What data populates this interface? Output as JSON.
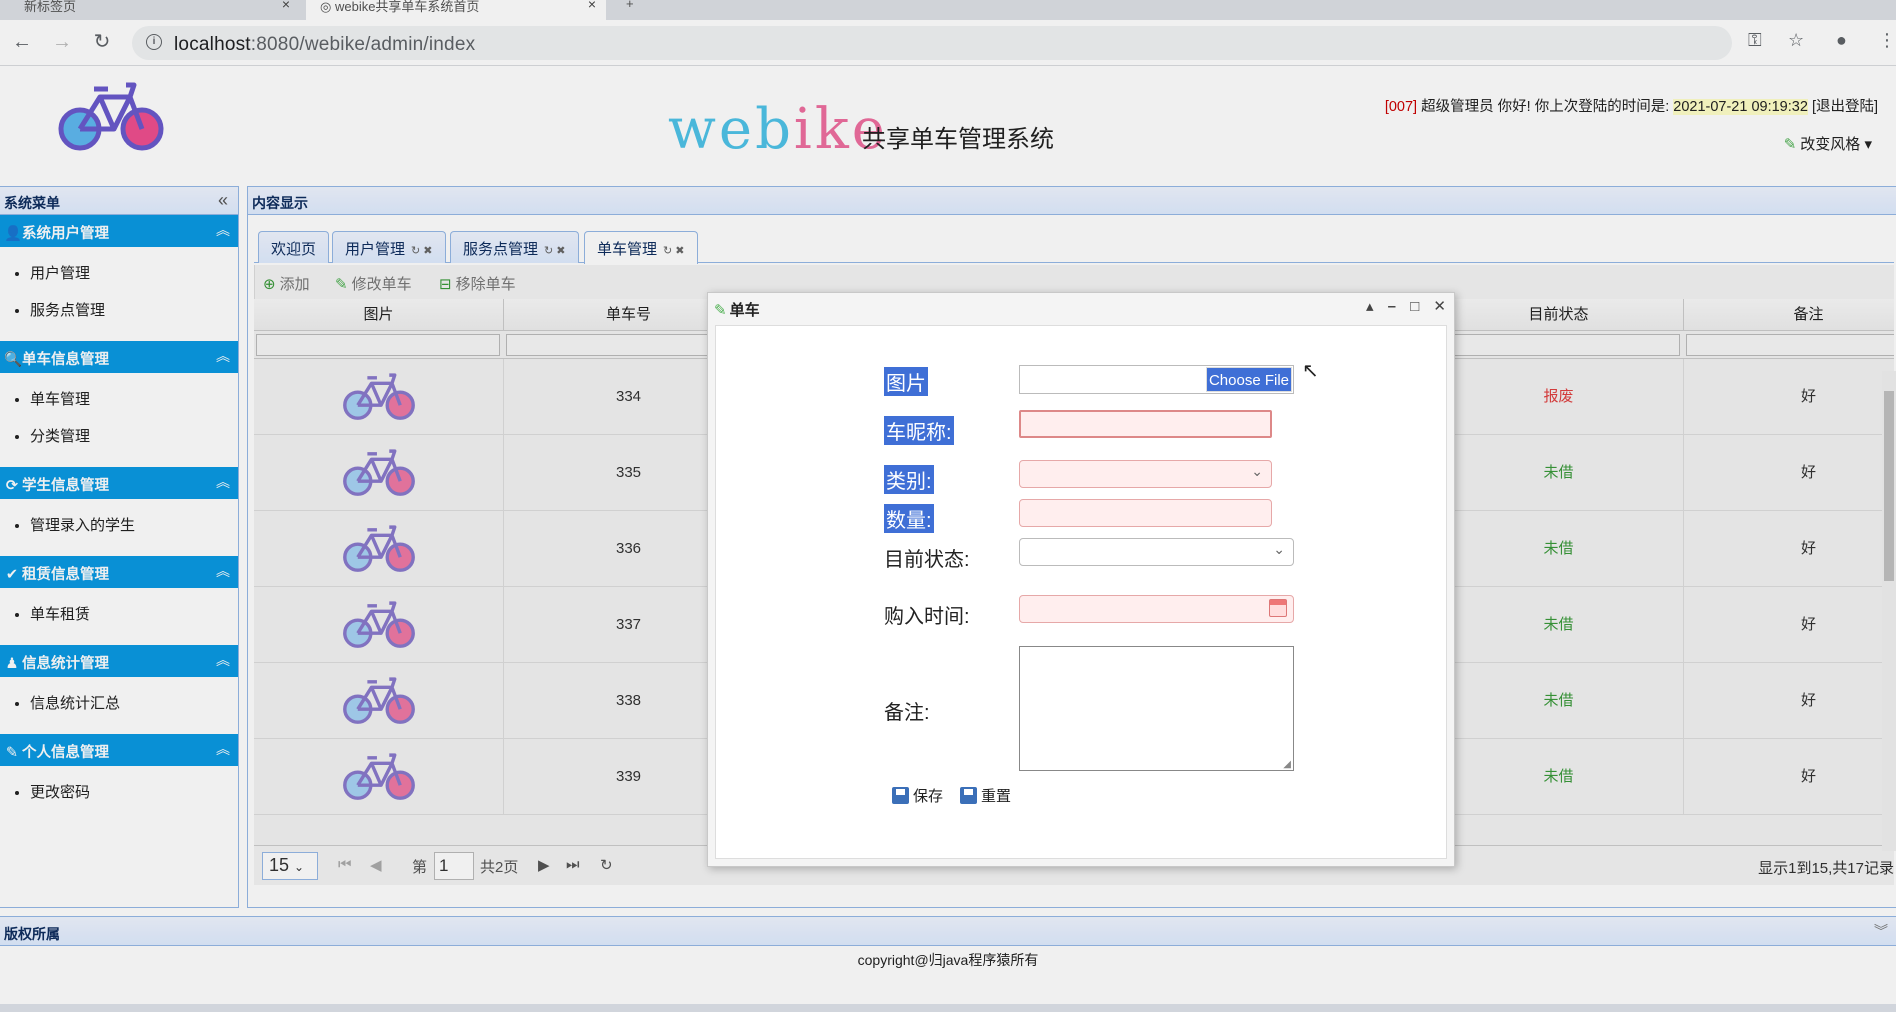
{
  "browser": {
    "tabs": [
      {
        "label": "新标签页"
      },
      {
        "label": "webike共享单车系统首页"
      }
    ],
    "url_host": "localhost",
    "url_path": ":8080/webike/admin/index"
  },
  "header": {
    "brand_left": "web",
    "brand_right": "ike",
    "subtitle": "共享单车管理系统",
    "user_id": "[007]",
    "greeting": " 超级管理员 你好! 你上次登陆的时间是: ",
    "last_login": "2021-07-21 09:19:32",
    "logout": "[退出登陆]",
    "change_style": "改变风格"
  },
  "sidebar": {
    "title": "系统菜单",
    "groups": [
      {
        "title": "系统用户管理",
        "items": [
          "用户管理",
          "服务点管理"
        ]
      },
      {
        "title": "单车信息管理",
        "items": [
          "单车管理",
          "分类管理"
        ]
      },
      {
        "title": "学生信息管理",
        "items": [
          "管理录入的学生"
        ]
      },
      {
        "title": "租赁信息管理",
        "items": [
          "单车租赁"
        ]
      },
      {
        "title": "信息统计管理",
        "items": [
          "信息统计汇总"
        ]
      },
      {
        "title": "个人信息管理",
        "items": [
          "更改密码"
        ]
      }
    ]
  },
  "content": {
    "title": "内容显示",
    "tabs": [
      "欢迎页",
      "用户管理",
      "服务点管理",
      "单车管理"
    ],
    "toolbar": {
      "add": "添加",
      "edit": "修改单车",
      "remove": "移除单车"
    },
    "columns": [
      "图片",
      "单车号",
      "目前状态",
      "备注"
    ],
    "rows": [
      {
        "id": "334",
        "status": "报废",
        "note": "好"
      },
      {
        "id": "335",
        "status": "未借",
        "note": "好"
      },
      {
        "id": "336",
        "status": "未借",
        "note": "好"
      },
      {
        "id": "337",
        "status": "未借",
        "note": "好"
      },
      {
        "id": "338",
        "status": "未借",
        "note": "好"
      },
      {
        "id": "339",
        "status": "未借",
        "note": "好"
      }
    ],
    "pager": {
      "page_size": "15",
      "page_prefix": "第",
      "page": "1",
      "page_total": "共2页",
      "summary": "显示1到15,共17记录"
    }
  },
  "dialog": {
    "title": "单车",
    "labels": {
      "picture": "图片",
      "nickname": "车昵称:",
      "category": "类别:",
      "quantity": "数量:",
      "status": "目前状态:",
      "purchase_time": "购入时间:",
      "note": "备注:"
    },
    "file_button": "Choose File",
    "save": "保存",
    "reset": "重置"
  },
  "footer": {
    "title": "版权所属",
    "copyright": "copyright@归java程序猿所有"
  },
  "colors": {
    "accent": "#0a9ae3",
    "selection": "#3f6fd6",
    "status_scrapped": "#e04040",
    "status_available": "#3a9a3a"
  }
}
